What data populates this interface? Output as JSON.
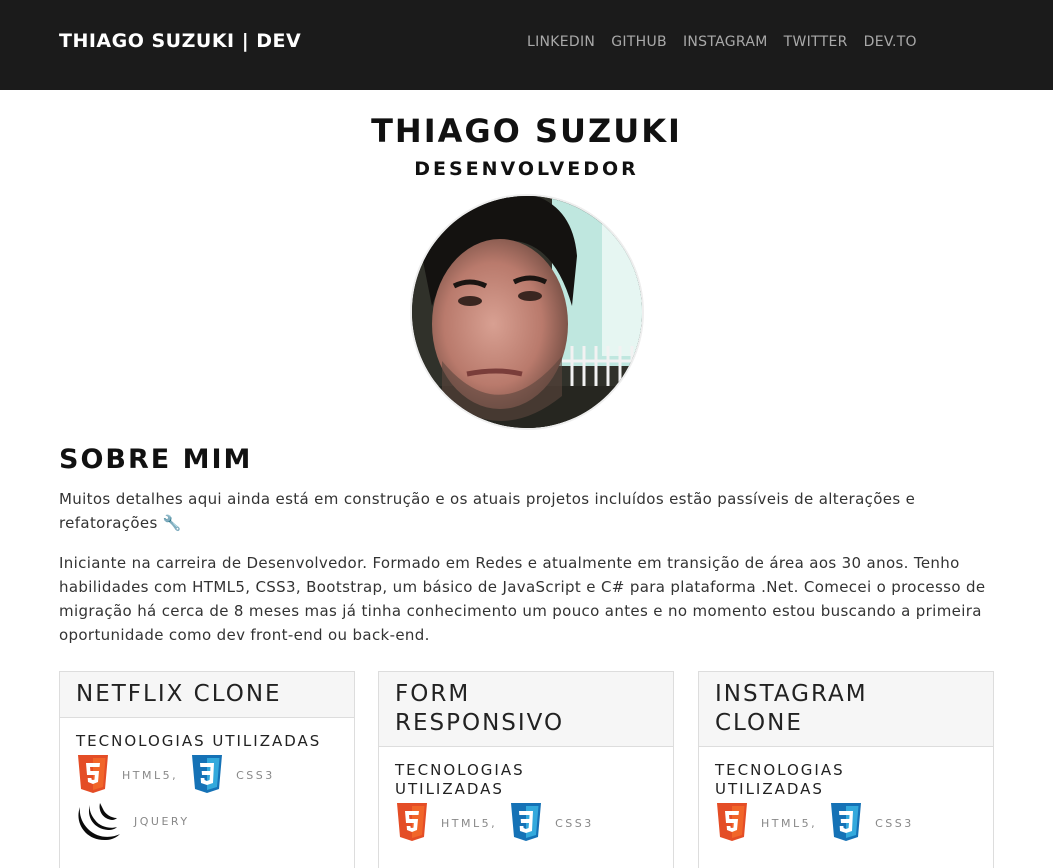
{
  "navbar": {
    "brand": "THIAGO SUZUKI | DEV",
    "links": [
      "LINKEDIN",
      "GITHUB",
      "INSTAGRAM",
      "TWITTER",
      "DEV.TO"
    ]
  },
  "hero": {
    "name": "THIAGO SUZUKI",
    "role": "DESENVOLVEDOR"
  },
  "about": {
    "title": "SOBRE MIM",
    "paragraph1": "Muitos detalhes aqui ainda está em construção e os atuais projetos incluídos estão passíveis de alterações e refatorações 🔧",
    "paragraph2": "Iniciante na carreira de Desenvolvedor. Formado em Redes e atualmente em transição de área aos 30 anos. Tenho habilidades com HTML5, CSS3, Bootstrap, um básico de JavaScript e C# para plataforma .Net. Comecei o processo de migração há cerca de 8 meses mas já tinha conhecimento um pouco antes e no momento estou buscando a primeira oportunidade como dev front-end ou back-end."
  },
  "projects": [
    {
      "title": "NETFLIX CLONE",
      "tech_title": "TECNOLOGIAS UTILIZADAS",
      "techs": [
        "HTML5,",
        "CSS3",
        "JQUERY"
      ]
    },
    {
      "title": "FORM RESPONSIVO",
      "tech_title": "TECNOLOGIAS UTILIZADAS",
      "techs": [
        "HTML5,",
        "CSS3"
      ]
    },
    {
      "title": "INSTAGRAM CLONE",
      "tech_title": "TECNOLOGIAS UTILIZADAS",
      "techs": [
        "HTML5,",
        "CSS3"
      ]
    }
  ],
  "icons": {
    "html5": "html5-logo-icon",
    "css3": "css3-logo-icon",
    "jquery": "jquery-logo-icon"
  },
  "colors": {
    "navbar": "#1b1b1b",
    "html5": "#e44d26",
    "css3": "#1572b6"
  }
}
